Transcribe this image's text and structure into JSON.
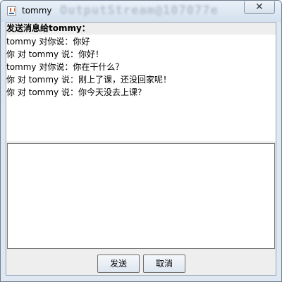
{
  "window": {
    "title": "tommy",
    "ghost_title": "OutputStream@107077e",
    "close_glyph": "✕"
  },
  "chat": {
    "header": "发送消息给tommy：",
    "messages": [
      "tommy 对你说：你好",
      "你 对 tommy 说：你好！",
      "tommy 对你说：你在干什么？",
      "你 对 tommy 说：刚上了课，还没回家呢！",
      "你 对 tommy 说：你今天没去上课？"
    ],
    "input_value": ""
  },
  "buttons": {
    "send": "发送",
    "cancel": "取消"
  }
}
